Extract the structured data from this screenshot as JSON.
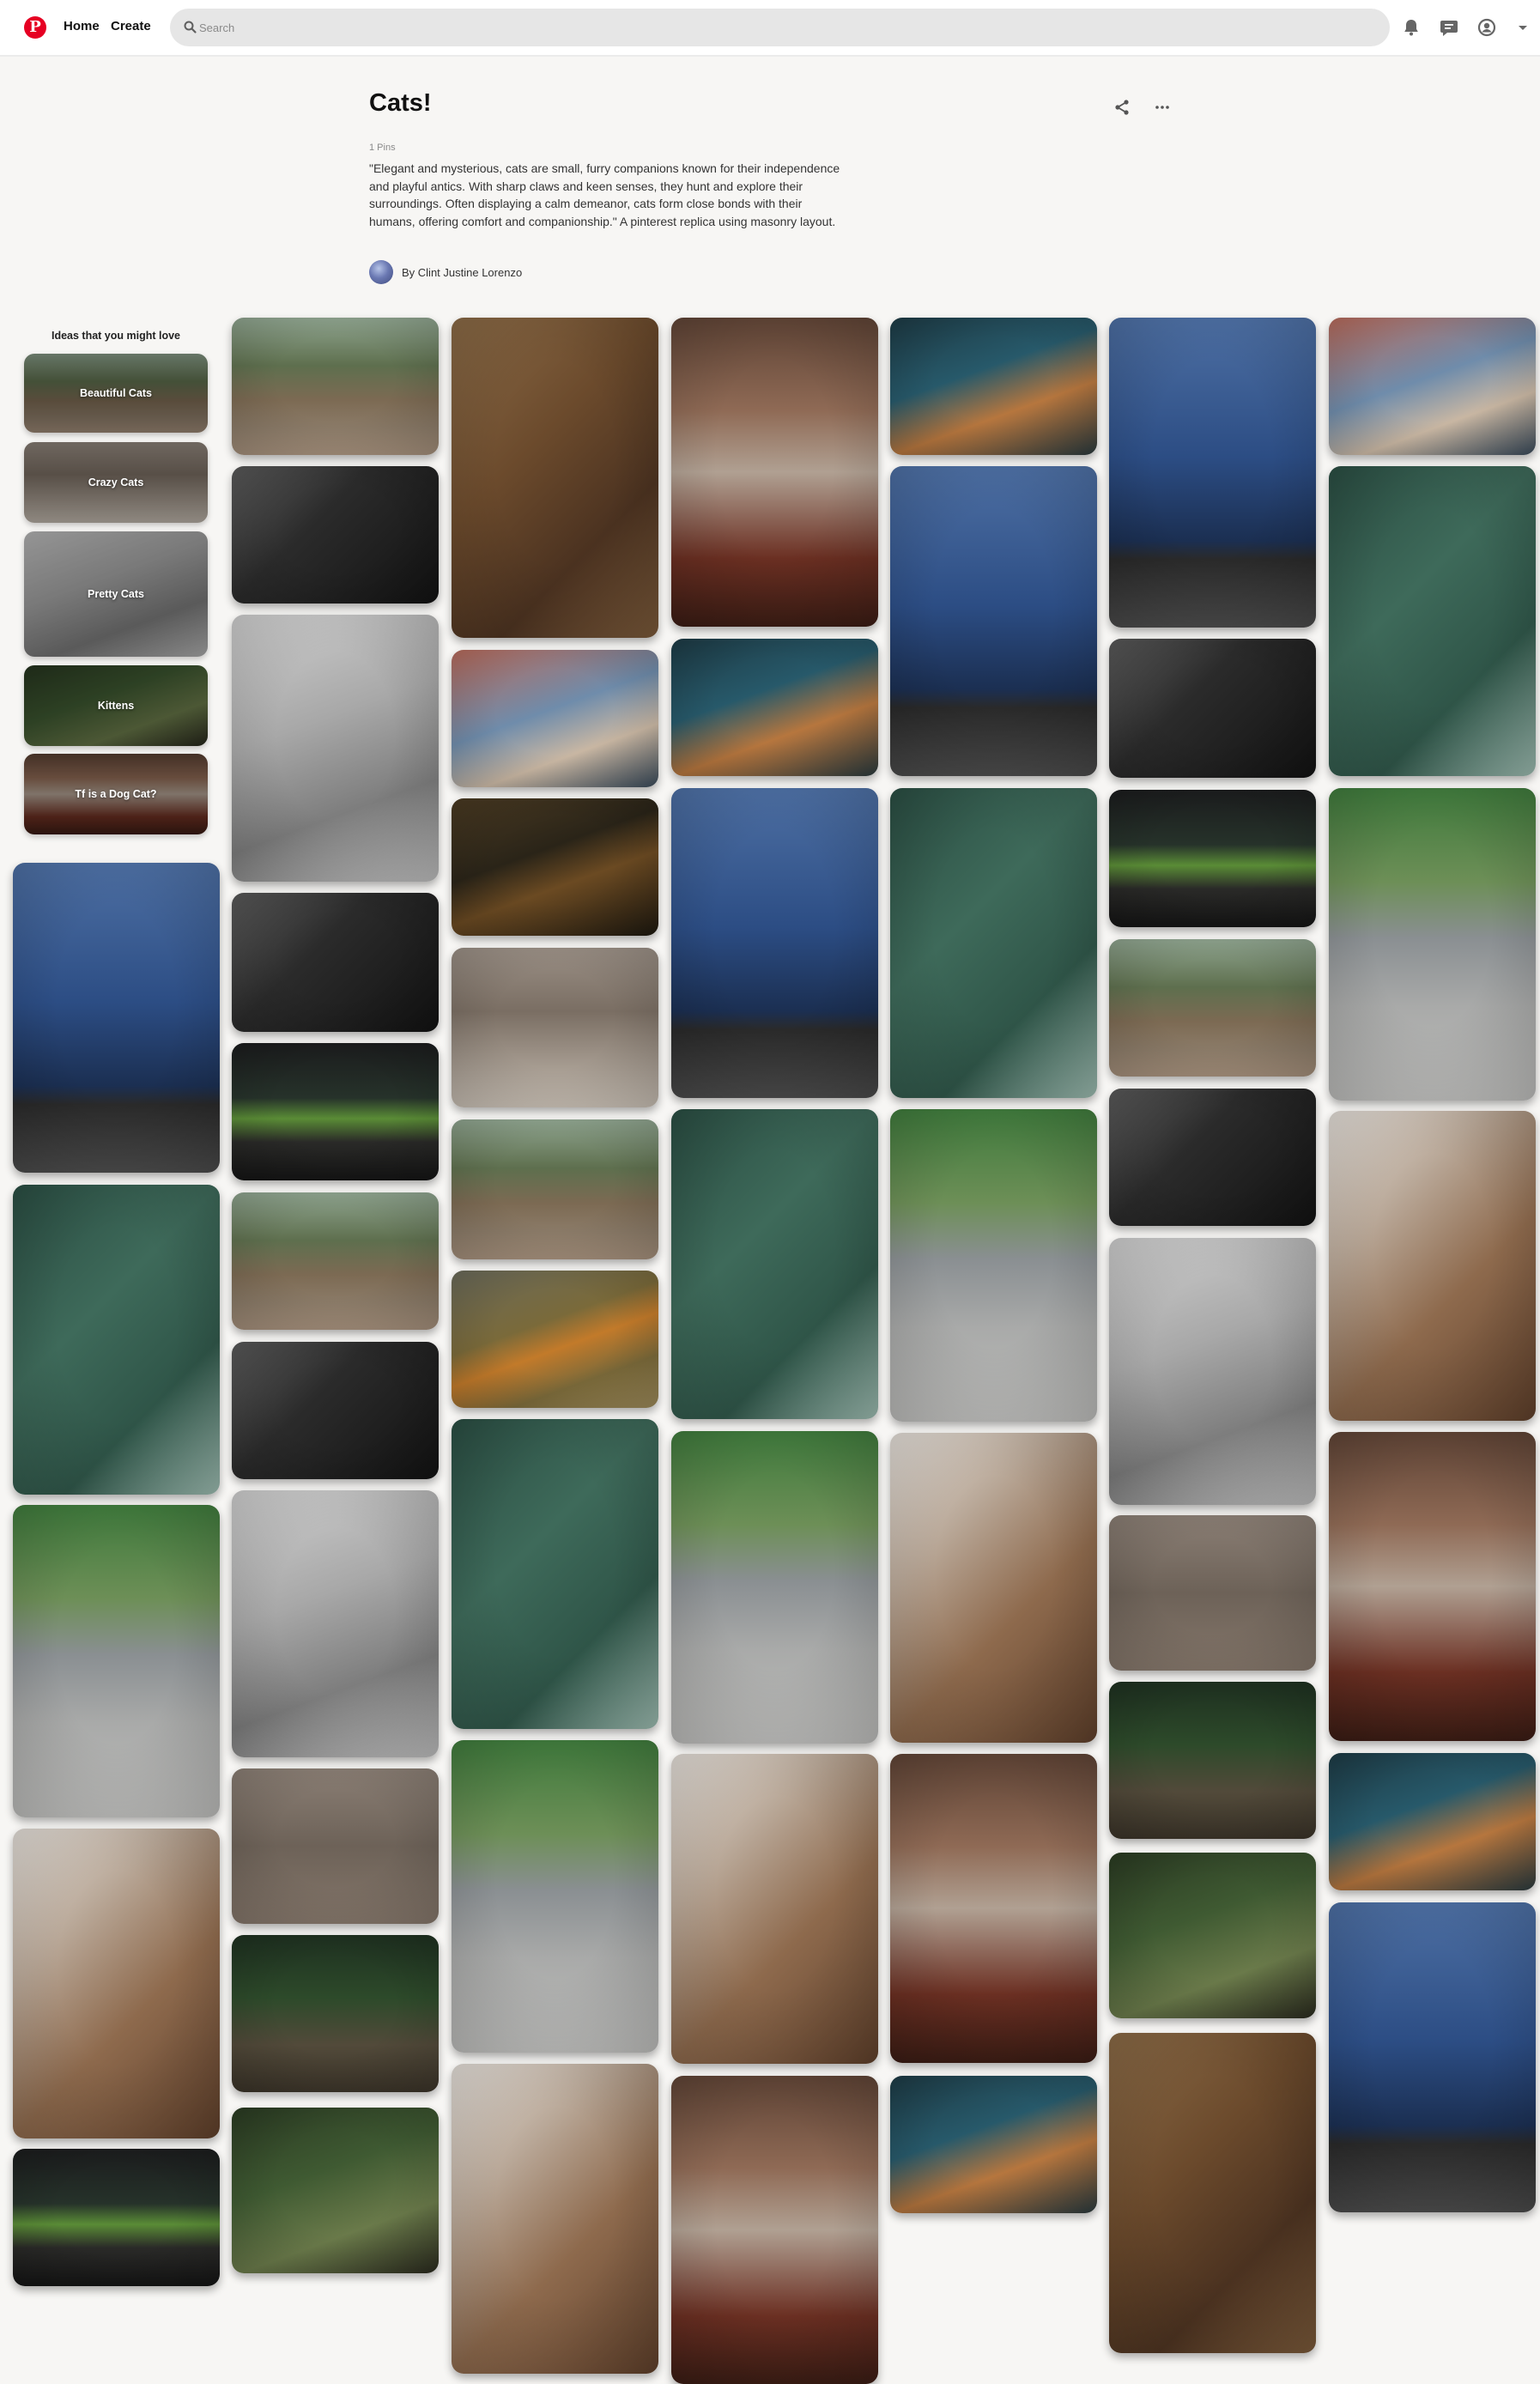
{
  "header": {
    "logo_letter": "P",
    "home_label": "Home",
    "create_label": "Create",
    "search_placeholder": "Search"
  },
  "board": {
    "title": "Cats!",
    "pin_count": "1 Pins",
    "description": "\"Elegant and mysterious, cats are small, furry companions known for their independence and playful antics. With sharp claws and keen senses, they hunt and explore their surroundings. Often displaying a calm demeanor, cats form close bonds with their humans, offering comfort and companionship.\" A pinterest replica using masonry layout.",
    "author": "By Clint Justine Lorenzo"
  },
  "ideas": {
    "title": "Ideas that you might love",
    "items": [
      {
        "label": "Beautiful Cats"
      },
      {
        "label": "Crazy Cats"
      },
      {
        "label": "Pretty Cats"
      },
      {
        "label": "Kittens"
      },
      {
        "label": "Tf is a Dog Cat?"
      }
    ]
  },
  "colors": {
    "brand": "#e60023",
    "search_bg": "#e6e6e6",
    "page_bg": "#f7f6f4"
  }
}
